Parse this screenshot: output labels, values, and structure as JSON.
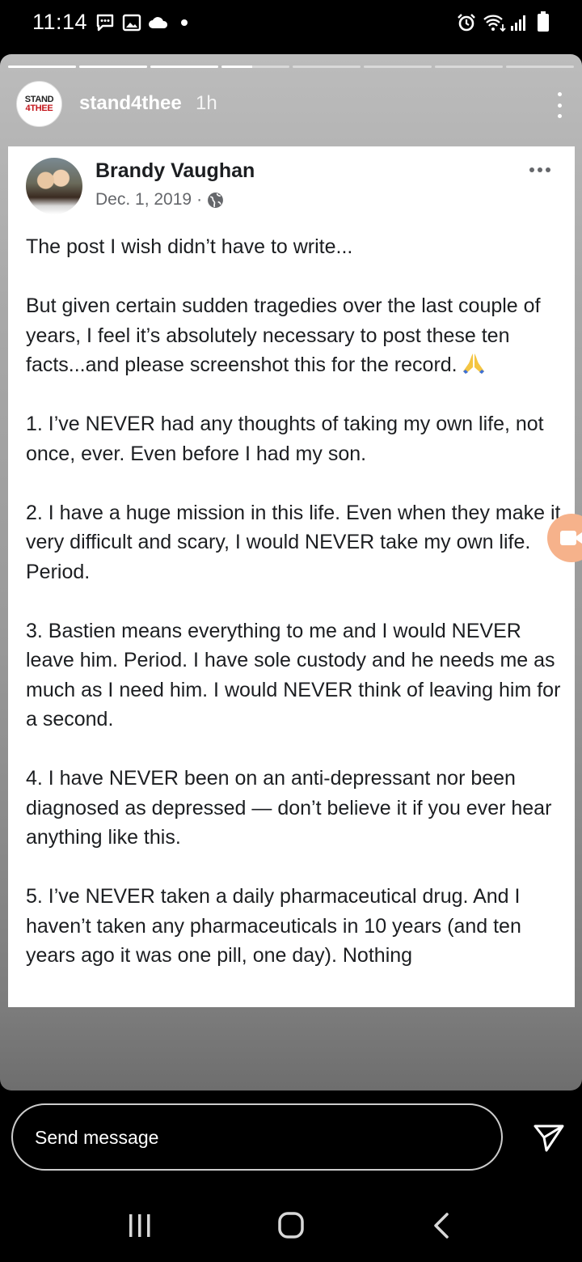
{
  "status_bar": {
    "time": "11:14",
    "icons": [
      "chat-bubble-icon",
      "gallery-icon",
      "cloud-icon",
      "dot-icon",
      "alarm-icon",
      "wifi-icon",
      "signal-icon",
      "battery-icon"
    ]
  },
  "story": {
    "progress": {
      "segments": 8,
      "current_index": 3,
      "current_fill_fraction": 0.45
    },
    "username": "stand4thee",
    "time_ago": "1h",
    "avatar_text": {
      "line1": "STAND",
      "line2": "4THEE"
    },
    "colors": {
      "avatar_accent": "#c4161c"
    }
  },
  "post": {
    "author": "Brandy Vaughan",
    "date": "Dec. 1, 2019",
    "separator": "·",
    "audience_icon": "globe-icon",
    "paragraphs": [
      "The post I wish didn’t have to write...",
      "But given certain sudden tragedies over the last couple of years, I feel it’s absolutely necessary to post these ten facts...and please screenshot this for the record.",
      "1. I’ve NEVER had any thoughts of taking my own life, not once, ever. Even before I had my son.",
      "2. I have a huge mission in this life. Even when they make it very difficult and scary, I would NEVER take my own life. Period.",
      "3. Bastien means everything to me and I would NEVER leave him. Period. I have sole custody and he needs me as much as I need him. I would NEVER think of leaving him for a second.",
      "4. I have NEVER been on an anti-depressant nor been diagnosed as depressed — don’t believe it if you ever hear anything like this.",
      "5. I’ve NEVER taken a daily pharmaceutical drug. And I haven’t taken any pharmaceuticals in 10 years (and ten years ago it was one pill, one day). Nothing"
    ]
  },
  "reply": {
    "placeholder": "Send message",
    "send_icon": "send-icon"
  },
  "navbar": {
    "icons": [
      "recents-icon",
      "home-icon",
      "back-icon"
    ]
  }
}
